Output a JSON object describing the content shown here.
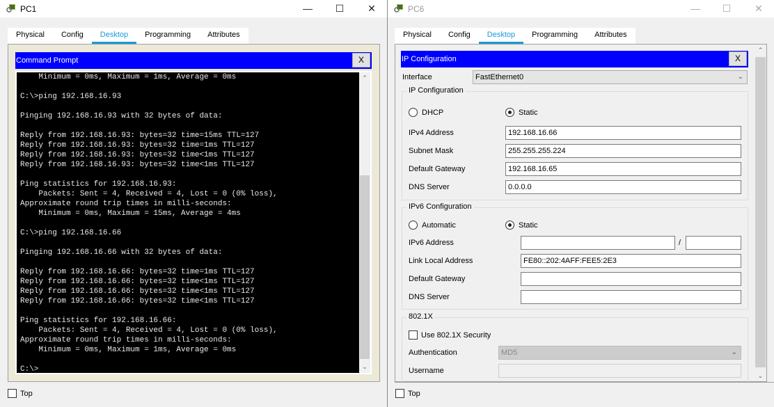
{
  "pc1": {
    "title": "PC1",
    "tabs": [
      "Physical",
      "Config",
      "Desktop",
      "Programming",
      "Attributes"
    ],
    "active_tab": "Desktop",
    "app_title": "Command Prompt",
    "close_label": "X",
    "terminal_lines": [
      "    Minimum = 0ms, Maximum = 1ms, Average = 0ms",
      "",
      "C:\\>ping 192.168.16.93",
      "",
      "Pinging 192.168.16.93 with 32 bytes of data:",
      "",
      "Reply from 192.168.16.93: bytes=32 time=15ms TTL=127",
      "Reply from 192.168.16.93: bytes=32 time=1ms TTL=127",
      "Reply from 192.168.16.93: bytes=32 time<1ms TTL=127",
      "Reply from 192.168.16.93: bytes=32 time<1ms TTL=127",
      "",
      "Ping statistics for 192.168.16.93:",
      "    Packets: Sent = 4, Received = 4, Lost = 0 (0% loss),",
      "Approximate round trip times in milli-seconds:",
      "    Minimum = 0ms, Maximum = 15ms, Average = 4ms",
      "",
      "C:\\>ping 192.168.16.66",
      "",
      "Pinging 192.168.16.66 with 32 bytes of data:",
      "",
      "Reply from 192.168.16.66: bytes=32 time=1ms TTL=127",
      "Reply from 192.168.16.66: bytes=32 time<1ms TTL=127",
      "Reply from 192.168.16.66: bytes=32 time<1ms TTL=127",
      "Reply from 192.168.16.66: bytes=32 time<1ms TTL=127",
      "",
      "Ping statistics for 192.168.16.66:",
      "    Packets: Sent = 4, Received = 4, Lost = 0 (0% loss),",
      "Approximate round trip times in milli-seconds:",
      "    Minimum = 0ms, Maximum = 1ms, Average = 0ms",
      "",
      "C:\\>"
    ],
    "top_label": "Top"
  },
  "pc6": {
    "title": "PC6",
    "tabs": [
      "Physical",
      "Config",
      "Desktop",
      "Programming",
      "Attributes"
    ],
    "active_tab": "Desktop",
    "app_title": "IP Configuration",
    "close_label": "X",
    "interface_label": "Interface",
    "interface_value": "FastEthernet0",
    "ipv4": {
      "group": "IP Configuration",
      "dhcp": "DHCP",
      "static": "Static",
      "mode": "Static",
      "address_label": "IPv4 Address",
      "address": "192.168.16.66",
      "mask_label": "Subnet Mask",
      "mask": "255.255.255.224",
      "gateway_label": "Default Gateway",
      "gateway": "192.168.16.65",
      "dns_label": "DNS Server",
      "dns": "0.0.0.0"
    },
    "ipv6": {
      "group": "IPv6 Configuration",
      "automatic": "Automatic",
      "static": "Static",
      "mode": "Static",
      "address_label": "IPv6 Address",
      "address": "",
      "prefix_sep": "/",
      "prefix": "",
      "link_local_label": "Link Local Address",
      "link_local": "FE80::202:4AFF:FEE5:2E3",
      "gateway_label": "Default Gateway",
      "gateway": "",
      "dns_label": "DNS Server",
      "dns": ""
    },
    "dot1x": {
      "group": "802.1X",
      "use_label": "Use 802.1X Security",
      "use_checked": false,
      "auth_label": "Authentication",
      "auth_value": "MD5",
      "username_label": "Username",
      "username": ""
    },
    "top_label": "Top"
  }
}
